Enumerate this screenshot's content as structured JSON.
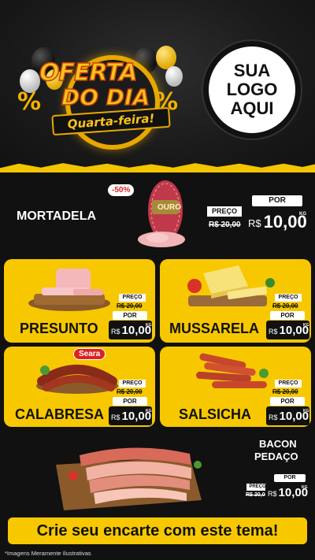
{
  "header": {
    "badge_line1": "OFERTA",
    "badge_line2": "DO DIA",
    "badge_line3": "Quarta-feira!",
    "logo_line1": "SUA",
    "logo_line2": "LOGO",
    "logo_line3": "AQUI"
  },
  "products": {
    "mortadela": {
      "name": "MORTADELA",
      "discount": "-50%",
      "brand": "OURO",
      "preco_label": "PREÇO",
      "old_price": "R$ 20,00",
      "por_label": "POR",
      "currency": "R$",
      "price": "10,00",
      "unit": "KG"
    },
    "presunto": {
      "name": "PRESUNTO",
      "preco_label": "PREÇO",
      "old_price": "R$ 20,00",
      "por_label": "POR",
      "currency": "R$",
      "price": "10,00",
      "unit": "KG"
    },
    "mussarela": {
      "name": "MUSSARELA",
      "preco_label": "PREÇO",
      "old_price": "R$ 20,00",
      "por_label": "POR",
      "currency": "R$",
      "price": "10,00",
      "unit": "KG"
    },
    "calabresa": {
      "name": "CALABRESA",
      "brand": "Seara",
      "preco_label": "PREÇO",
      "old_price": "R$ 20,00",
      "por_label": "POR",
      "currency": "R$",
      "price": "10,00",
      "unit": "KG"
    },
    "salsicha": {
      "name": "SALSICHA",
      "preco_label": "PREÇO",
      "old_price": "R$ 20,00",
      "por_label": "POR",
      "currency": "R$",
      "price": "10,00",
      "unit": "KG"
    },
    "bacon": {
      "name_line1": "BACON",
      "name_line2": "PEDAÇO",
      "preco_label": "PREÇO",
      "old_price": "R$ 20,00",
      "por_label": "POR",
      "currency": "R$",
      "price": "10,00",
      "unit": "KG"
    }
  },
  "cta": {
    "label": "Crie seu encarte com este tema!"
  },
  "footnote": "*Imagens Meramente Ilustrativas",
  "colors": {
    "accent_yellow": "#f7c800",
    "dark": "#111111",
    "discount_red": "#e02020"
  }
}
